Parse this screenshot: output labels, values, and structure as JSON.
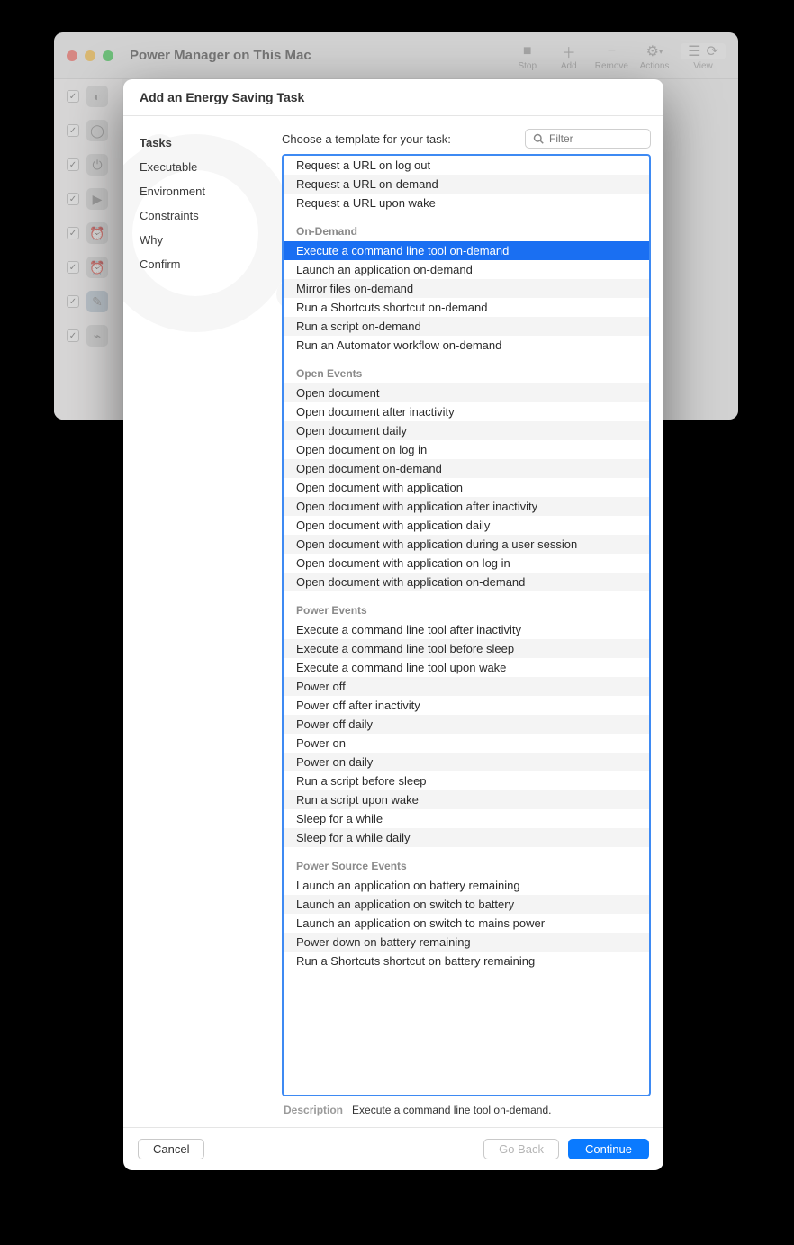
{
  "window": {
    "title": "Power Manager on This Mac",
    "toolbar": {
      "stop": "Stop",
      "add": "Add",
      "remove": "Remove",
      "actions": "Actions",
      "view": "View"
    }
  },
  "sheet": {
    "title": "Add an Energy Saving Task",
    "steps": [
      "Tasks",
      "Executable",
      "Environment",
      "Constraints",
      "Why",
      "Confirm"
    ],
    "current_step": 0,
    "prompt": "Choose a template for your task:",
    "filter_placeholder": "Filter",
    "groups": [
      {
        "title": "",
        "items": [
          "Request a URL on log out",
          "Request a URL on-demand",
          "Request a URL upon wake"
        ]
      },
      {
        "title": "On-Demand",
        "items": [
          "Execute a command line tool on-demand",
          "Launch an application on-demand",
          "Mirror files on-demand",
          "Run a Shortcuts shortcut on-demand",
          "Run a script on-demand",
          "Run an Automator workflow on-demand"
        ]
      },
      {
        "title": "Open Events",
        "items": [
          "Open document",
          "Open document after inactivity",
          "Open document daily",
          "Open document on log in",
          "Open document on-demand",
          "Open document with application",
          "Open document with application after inactivity",
          "Open document with application daily",
          "Open document with application during a user session",
          "Open document with application on log in",
          "Open document with application on-demand"
        ]
      },
      {
        "title": "Power Events",
        "items": [
          "Execute a command line tool after inactivity",
          "Execute a command line tool before sleep",
          "Execute a command line tool upon wake",
          "Power off",
          "Power off after inactivity",
          "Power off daily",
          "Power on",
          "Power on daily",
          "Run a script before sleep",
          "Run a script upon wake",
          "Sleep for a while",
          "Sleep for a while daily"
        ]
      },
      {
        "title": "Power Source Events",
        "items": [
          "Launch an application on battery remaining",
          "Launch an application on switch to battery",
          "Launch an application on switch to mains power",
          "Power down on battery remaining",
          "Run a Shortcuts shortcut on battery remaining"
        ]
      }
    ],
    "selected": "Execute a command line tool on-demand",
    "description_label": "Description",
    "description_text": "Execute a command line tool on-demand.",
    "buttons": {
      "cancel": "Cancel",
      "back": "Go Back",
      "continue": "Continue"
    }
  }
}
